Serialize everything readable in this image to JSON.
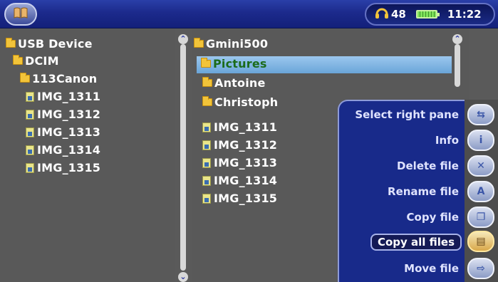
{
  "topbar": {
    "volume": "48",
    "time": "11:22",
    "icons": {
      "home": "home-icon",
      "volume": "headphones-icon",
      "battery": "battery-icon"
    }
  },
  "left_pane": {
    "rows": [
      {
        "label": "USB Device",
        "icon": "folder-icon"
      },
      {
        "label": "DCIM",
        "icon": "folder-icon"
      },
      {
        "label": "113Canon",
        "icon": "folder-icon"
      },
      {
        "label": "IMG_1311",
        "icon": "image-file-icon"
      },
      {
        "label": "IMG_1312",
        "icon": "image-file-icon"
      },
      {
        "label": "IMG_1313",
        "icon": "image-file-icon"
      },
      {
        "label": "IMG_1314",
        "icon": "image-file-icon"
      },
      {
        "label": "IMG_1315",
        "icon": "image-file-icon"
      }
    ]
  },
  "right_pane": {
    "rows": [
      {
        "label": "Gmini500",
        "icon": "folder-icon"
      },
      {
        "label": "Pictures",
        "icon": "folder-icon",
        "selected": true
      },
      {
        "label": "Antoine",
        "icon": "folder-icon"
      },
      {
        "label": "Christoph",
        "icon": "folder-icon"
      },
      {
        "label": "IMG_1311",
        "icon": "image-file-icon"
      },
      {
        "label": "IMG_1312",
        "icon": "image-file-icon"
      },
      {
        "label": "IMG_1313",
        "icon": "image-file-icon"
      },
      {
        "label": "IMG_1314",
        "icon": "image-file-icon"
      },
      {
        "label": "IMG_1315",
        "icon": "image-file-icon"
      }
    ]
  },
  "menu": {
    "items": [
      {
        "label": "Select right pane",
        "icon": "select-pane-icon"
      },
      {
        "label": "Info",
        "icon": "info-icon"
      },
      {
        "label": "Delete file",
        "icon": "delete-icon"
      },
      {
        "label": "Rename file",
        "icon": "rename-icon"
      },
      {
        "label": "Copy file",
        "icon": "copy-file-icon"
      },
      {
        "label": "Copy all files",
        "icon": "copy-all-icon",
        "active": true
      },
      {
        "label": "Move file",
        "icon": "move-file-icon"
      }
    ]
  },
  "colors": {
    "topbar": "#1c2a8c",
    "pane_bg": "#595959",
    "highlight": "#7db3e0",
    "menu_bg": "#182a8a",
    "folder": "#f2c43a",
    "selected_text": "#1b6b1b"
  }
}
